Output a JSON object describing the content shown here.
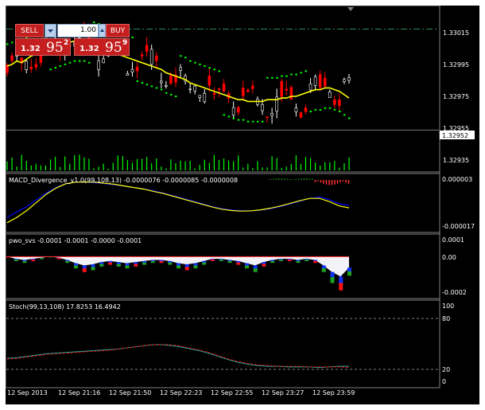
{
  "colors": {
    "background": "#000000",
    "up_candle": "#00ff00",
    "down_candle": "#ff0000",
    "neutral_candle": "#ffffff",
    "ma_line": "#ffff00",
    "psar": "#00ff00",
    "macd_line": "#0000ff",
    "signal_line": "#ffff00",
    "stoch_main": "#20b2aa",
    "stoch_signal": "#ff0000",
    "sell_button": "#c41e1e"
  },
  "trade_panel": {
    "sell_label": "SELL",
    "buy_label": "BUY",
    "lot_value": "1.00",
    "sell_price_prefix": "1.32",
    "sell_price_big": "95",
    "sell_price_sup": "2",
    "buy_price_prefix": "1.32",
    "buy_price_big": "95",
    "buy_price_sup": "9",
    "dropdown_icon": "chevron-down-icon",
    "spin_icon": "spin-up-icon"
  },
  "main_axis": {
    "ticks": [
      "1.33015",
      "1.32995",
      "1.32975",
      "1.32955",
      "1.32935"
    ],
    "current_price": "1.32952"
  },
  "macd": {
    "label": "MACD_Divergence_v1.0(99,108,13) -0.0000076 -0.0000085 -0.0000008",
    "ticks": [
      "0.000003",
      "-0.000017"
    ]
  },
  "pwo": {
    "label": "pwo_svs -0.0001 -0.0001 -0.0000 -0.0001",
    "ticks": [
      "0.0001",
      "0.00",
      "-0.0002"
    ]
  },
  "stoch": {
    "label": "Stoch(99,13,108) 17.8253 16.4942",
    "ticks": [
      "100",
      "80",
      "20",
      "0"
    ]
  },
  "time_axis": [
    "12 Sep 2013",
    "12 Sep 21:16",
    "12 Sep 21:50",
    "12 Sep 22:23",
    "12 Sep 22:55",
    "12 Sep 23:27",
    "12 Sep 23:59"
  ],
  "chart_data": [
    {
      "type": "candlestick",
      "title": "",
      "ylim": [
        1.32928,
        1.33025
      ],
      "reference_line": 1.33012,
      "bid_line": 1.32952,
      "series": [
        {
          "name": "",
          "values": [
            1.3299,
            1.32991,
            1.32993,
            1.32992,
            1.32994,
            1.32996,
            1.32997,
            1.32998,
            1.32999,
            1.33,
            1.33001,
            1.33002,
            1.33003,
            1.33004,
            1.33005,
            1.33005,
            1.33005,
            1.33004,
            1.33003,
            1.33002,
            1.33001,
            1.33,
            1.32999,
            1.32997,
            1.32996,
            1.32995,
            1.32994,
            1.32993,
            1.32992,
            1.32991,
            1.3299,
            1.32989,
            1.32988,
            1.32986,
            1.32985,
            1.32984,
            1.32983,
            1.32982,
            1.3298,
            1.32979,
            1.32978,
            1.32977,
            1.32976,
            1.32975,
            1.32974,
            1.32973,
            1.32972,
            1.32971,
            1.3297,
            1.3297,
            1.32969,
            1.32969,
            1.32969,
            1.32969,
            1.3297,
            1.3297,
            1.3297,
            1.32971,
            1.32971,
            1.32972,
            1.32972,
            1.32973,
            1.32974,
            1.32975,
            1.32976,
            1.32976,
            1.32977,
            1.32977,
            1.32976,
            1.32975,
            1.32973,
            1.32971
          ]
        }
      ]
    },
    {
      "type": "line",
      "title": "",
      "ylim": [
        -1.7e-05,
        3e-06
      ],
      "series": [
        {
          "name": "",
          "values": [
            -1.2e-05,
            -1e-05,
            -8e-06,
            -5.5e-06,
            -3e-06,
            -1e-06,
            5e-07,
            1e-06,
            1e-06,
            8e-07,
            4e-07,
            0.0,
            -5e-07,
            -1e-06,
            -1.5e-06,
            -2.2e-06,
            -3e-06,
            -4e-06,
            -5e-06,
            -6e-06,
            -7e-06,
            -8e-06,
            -8.8e-06,
            -9.3e-06,
            -9.5e-06,
            -9.6e-06,
            -9.3e-06,
            -8.8e-06,
            -8e-06,
            -7e-06,
            -6e-06,
            -5e-06,
            -4.5e-06,
            -5.5e-06,
            -7e-06,
            -7.6e-06
          ]
        },
        {
          "name": "",
          "values": [
            -1.4e-05,
            -1.2e-05,
            -9.5e-06,
            -6.5e-06,
            -3.5e-06,
            -1.2e-06,
            4e-07,
            1e-06,
            1.1e-06,
            1e-06,
            6e-07,
            2e-07,
            -4e-07,
            -1e-06,
            -1.6e-06,
            -2.4e-06,
            -3.2e-06,
            -4.2e-06,
            -5.2e-06,
            -6.2e-06,
            -7.2e-06,
            -8.2e-06,
            -9e-06,
            -9.5e-06,
            -9.7e-06,
            -9.6e-06,
            -9.2e-06,
            -8.6e-06,
            -7.8e-06,
            -6.8e-06,
            -5.8e-06,
            -5e-06,
            -5e-06,
            -6.2e-06,
            -7.8e-06,
            -8.5e-06
          ]
        }
      ]
    },
    {
      "type": "area",
      "title": "",
      "ylim": [
        -0.00022,
        0.00011
      ],
      "series": [
        {
          "name": "",
          "values": [
            0.0,
            -2e-05,
            -3e-05,
            -2e-05,
            -1e-05,
            0.0,
            -1e-05,
            -3e-05,
            -6e-05,
            -8e-05,
            -7e-05,
            -5e-05,
            -4e-05,
            -5e-05,
            -6e-05,
            -5e-05,
            -4e-05,
            -3e-05,
            -3e-05,
            -4e-05,
            -6e-05,
            -7e-05,
            -6e-05,
            -4e-05,
            -2e-05,
            -2e-05,
            -3e-05,
            -4e-05,
            -6e-05,
            -8e-05,
            -5e-05,
            -3e-05,
            -2e-05,
            -2e-05,
            -3e-05,
            -2e-05,
            -3e-05,
            -8e-05,
            -0.00014,
            -0.00018,
            -0.0001
          ]
        }
      ]
    },
    {
      "type": "line",
      "title": "",
      "ylim": [
        0,
        100
      ],
      "series": [
        {
          "name": "",
          "values": [
            30,
            31,
            33,
            35,
            37,
            38,
            39,
            40,
            41,
            42,
            43,
            44,
            46,
            48,
            50,
            51,
            50,
            48,
            45,
            42,
            38,
            33,
            28,
            24,
            21,
            19,
            18,
            18,
            17,
            17,
            17,
            16,
            17,
            18,
            18
          ]
        },
        {
          "name": "",
          "values": [
            29,
            30,
            32,
            34,
            36,
            37,
            38,
            39,
            40,
            41,
            42,
            44,
            46,
            48,
            50,
            51,
            51,
            49,
            46,
            43,
            39,
            34,
            29,
            25,
            22,
            20,
            19,
            18,
            18,
            18,
            17,
            17,
            17,
            17,
            16
          ]
        }
      ]
    }
  ]
}
